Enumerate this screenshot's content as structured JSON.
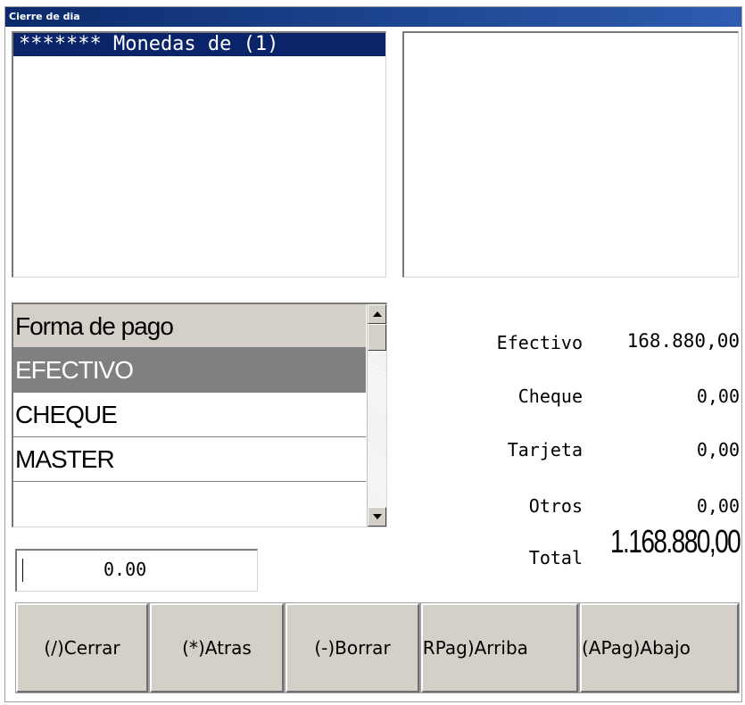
{
  "window": {
    "title": "Cierre de dia"
  },
  "coin_list": {
    "items": [
      "******* Monedas de (1)"
    ]
  },
  "payment_grid": {
    "header": "Forma de pago",
    "rows": [
      "EFECTIVO",
      "CHEQUE",
      "MASTER",
      ""
    ],
    "selected_index": 0
  },
  "totals": {
    "efectivo": {
      "label": "Efectivo",
      "value": "168.880,00"
    },
    "cheque": {
      "label": "Cheque",
      "value": "0,00"
    },
    "tarjeta": {
      "label": "Tarjeta",
      "value": "0,00"
    },
    "otros": {
      "label": "Otros",
      "value": "0,00"
    },
    "total": {
      "label": "Total",
      "value": "1.168.880,00"
    }
  },
  "amount_input": {
    "value": "0.00"
  },
  "buttons": {
    "cerrar": "(/)Cerrar",
    "atras": "(*)Atras",
    "borrar": "(-)Borrar",
    "arriba": "(RPag)Arriba",
    "abajo": "(APag)Abajo"
  },
  "colors": {
    "selection": "#0a246a",
    "grid_selected": "#808080",
    "button_face": "#d4d0c8"
  }
}
